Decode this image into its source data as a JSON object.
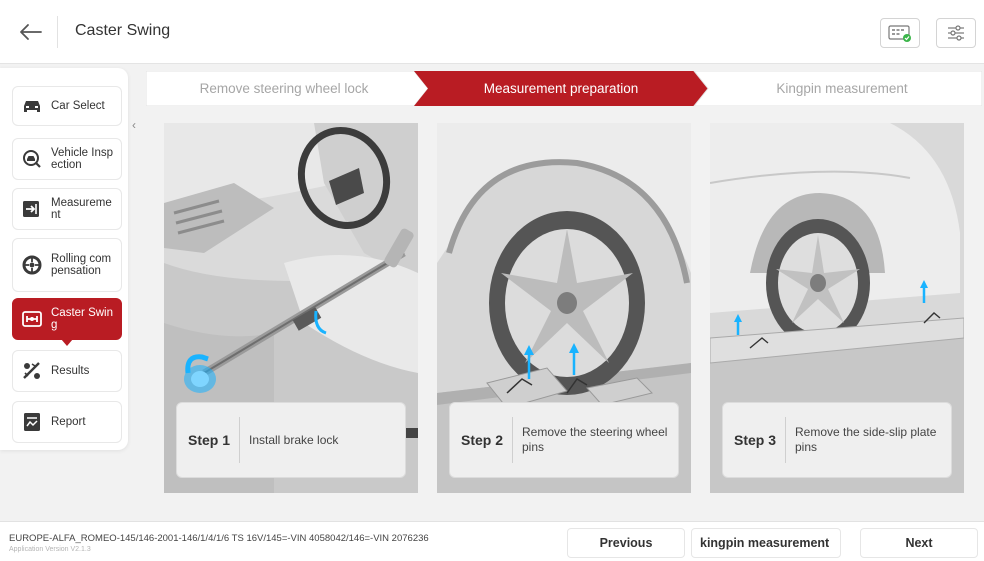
{
  "header": {
    "title": "Caster Swing",
    "back_icon": "arrow-left-icon",
    "right_icons": [
      "obd-device-icon",
      "settings-sliders-icon"
    ]
  },
  "sidebar": {
    "items": [
      {
        "label": "Car Select",
        "icon": "car-icon",
        "active": false
      },
      {
        "label": "Vehicle Inspection",
        "icon": "inspection-icon",
        "active": false
      },
      {
        "label": "Measurement",
        "icon": "measurement-icon",
        "active": false
      },
      {
        "label": "Rolling compensation",
        "icon": "wheel-icon",
        "active": false
      },
      {
        "label": "Caster Swing",
        "icon": "caster-icon",
        "active": true
      },
      {
        "label": "Results",
        "icon": "results-icon",
        "active": false
      },
      {
        "label": "Report",
        "icon": "report-icon",
        "active": false
      }
    ]
  },
  "progress": {
    "steps": [
      {
        "label": "Remove steering wheel lock",
        "state": "done"
      },
      {
        "label": "Measurement preparation",
        "state": "current"
      },
      {
        "label": "Kingpin measurement",
        "state": "pending"
      }
    ]
  },
  "panels": [
    {
      "step": "Step 1",
      "text": "Install brake lock"
    },
    {
      "step": "Step 2",
      "text": "Remove the steering wheel pins"
    },
    {
      "step": "Step 3",
      "text": "Remove the side-slip plate pins"
    }
  ],
  "footer": {
    "vehicle": "EUROPE-ALFA_ROMEO-145/146-2001-146/1/4/1/6 TS 16V/145=-VIN 4058042/146=-VIN 2076236",
    "version": "Application Version V2.1.3",
    "buttons": {
      "previous": "Previous",
      "middle": "kingpin measurement",
      "next": "Next"
    }
  },
  "colors": {
    "accent": "#b91c23",
    "background": "#f2f2f2",
    "panel_bg": "#d9d9d9",
    "highlight": "#19b3ff"
  }
}
